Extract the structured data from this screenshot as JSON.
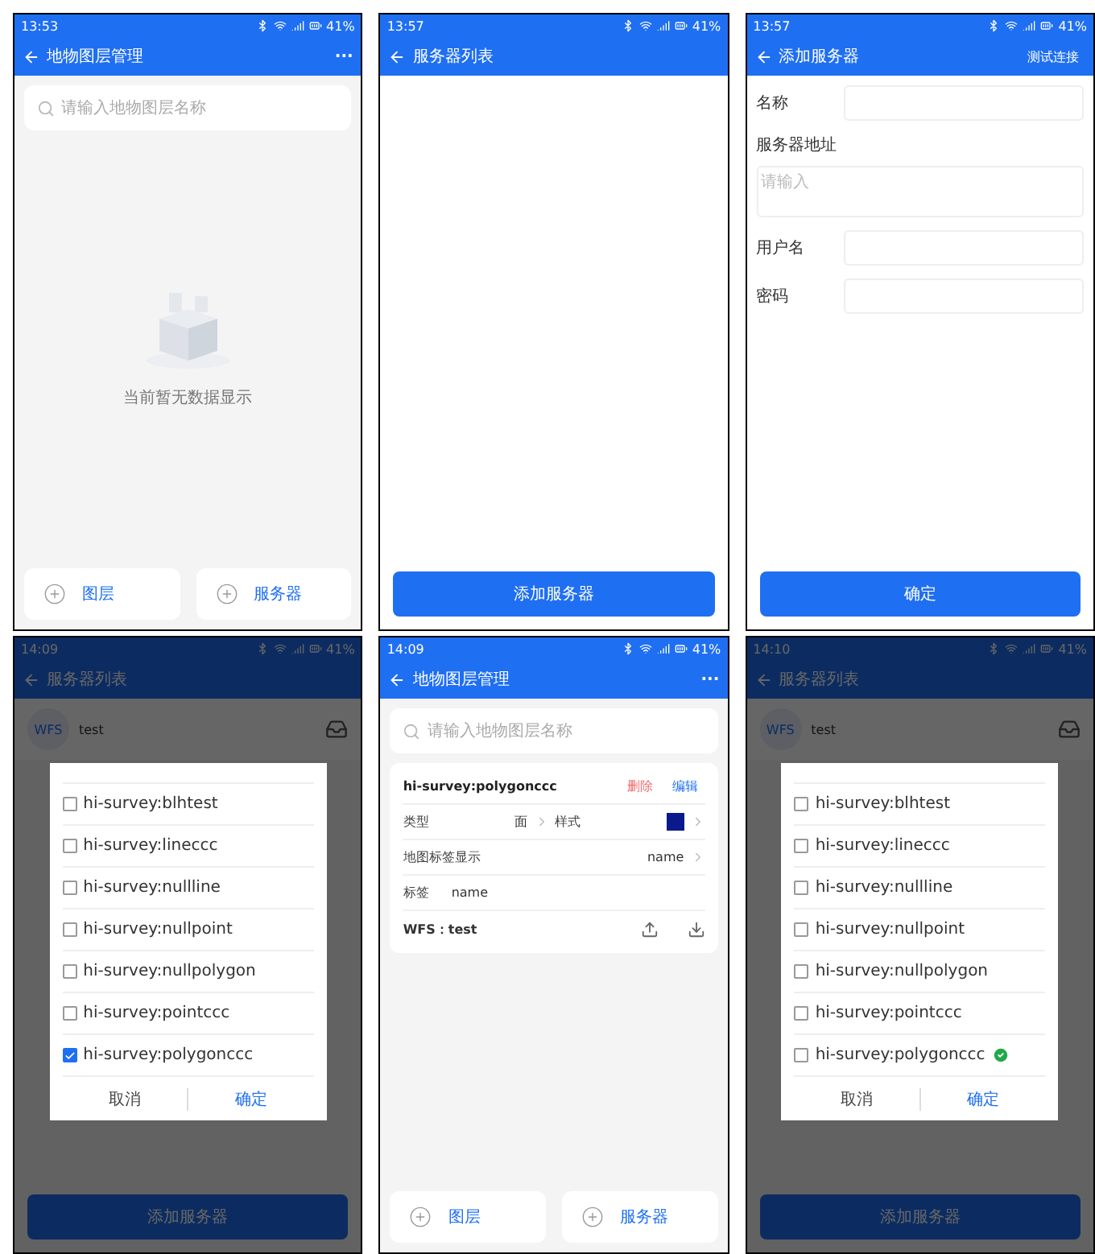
{
  "screens": [
    {
      "kind": "layer_list",
      "status": {
        "time": "13:53",
        "battery": "41%"
      },
      "header": {
        "title": "地物图层管理",
        "menu": "···"
      },
      "search": {
        "placeholder": "请输入地物图层名称"
      },
      "empty_text": "当前暂无数据显示",
      "footer": [
        "图层",
        "服务器"
      ]
    },
    {
      "kind": "server_list",
      "status": {
        "time": "13:57",
        "battery": "41%"
      },
      "header": {
        "title": "服务器列表"
      },
      "button": "添加服务器"
    },
    {
      "kind": "add_server",
      "status": {
        "time": "13:57",
        "battery": "41%"
      },
      "header": {
        "title": "添加服务器",
        "action": "测试连接"
      },
      "fields": [
        {
          "kind": "input",
          "label": "名称"
        },
        {
          "kind": "textarea",
          "label": "服务器地址",
          "placeholder": "请输入"
        },
        {
          "kind": "input",
          "label": "用户名"
        },
        {
          "kind": "input",
          "label": "密码"
        }
      ],
      "button": "确定"
    },
    {
      "kind": "server_dialog",
      "status": {
        "time": "14:09",
        "battery": "41%"
      },
      "header": {
        "title": "服务器列表"
      },
      "server": {
        "avatar": "WFS",
        "name": "test"
      },
      "button": "添加服务器",
      "dialog": {
        "items": [
          {
            "label": "hi-survey:blhtest",
            "checked": false,
            "loaded": false
          },
          {
            "label": "hi-survey:lineccc",
            "checked": false,
            "loaded": false
          },
          {
            "label": "hi-survey:nullline",
            "checked": false,
            "loaded": false
          },
          {
            "label": "hi-survey:nullpoint",
            "checked": false,
            "loaded": false
          },
          {
            "label": "hi-survey:nullpolygon",
            "checked": false,
            "loaded": false
          },
          {
            "label": "hi-survey:pointccc",
            "checked": false,
            "loaded": false
          },
          {
            "label": "hi-survey:polygonccc",
            "checked": true,
            "loaded": false
          }
        ],
        "cancel": "取消",
        "confirm": "确定"
      }
    },
    {
      "kind": "layer_list",
      "status": {
        "time": "14:09",
        "battery": "41%"
      },
      "header": {
        "title": "地物图层管理",
        "menu": "···"
      },
      "search": {
        "placeholder": "请输入地物图层名称"
      },
      "card": {
        "title": "hi-survey:polygonccc",
        "delete": "删除",
        "edit": "编辑",
        "rows": [
          {
            "kind": "type_style",
            "label": "类型",
            "value": "面",
            "label2": "样式",
            "color": "#0a1a8c"
          },
          {
            "kind": "select",
            "label": "地图标签显示",
            "value": "name"
          },
          {
            "kind": "text",
            "label": "标签",
            "value": "name"
          },
          {
            "kind": "source",
            "label": "WFS：test"
          }
        ]
      },
      "footer": [
        "图层",
        "服务器"
      ]
    },
    {
      "kind": "server_dialog",
      "status": {
        "time": "14:10",
        "battery": "41%"
      },
      "header": {
        "title": "服务器列表"
      },
      "server": {
        "avatar": "WFS",
        "name": "test"
      },
      "button": "添加服务器",
      "dialog": {
        "items": [
          {
            "label": "hi-survey:blhtest",
            "checked": false,
            "loaded": false
          },
          {
            "label": "hi-survey:lineccc",
            "checked": false,
            "loaded": false
          },
          {
            "label": "hi-survey:nullline",
            "checked": false,
            "loaded": false
          },
          {
            "label": "hi-survey:nullpoint",
            "checked": false,
            "loaded": false
          },
          {
            "label": "hi-survey:nullpolygon",
            "checked": false,
            "loaded": false
          },
          {
            "label": "hi-survey:pointccc",
            "checked": false,
            "loaded": false
          },
          {
            "label": "hi-survey:polygonccc",
            "checked": false,
            "loaded": true
          }
        ],
        "cancel": "取消",
        "confirm": "确定"
      }
    }
  ]
}
